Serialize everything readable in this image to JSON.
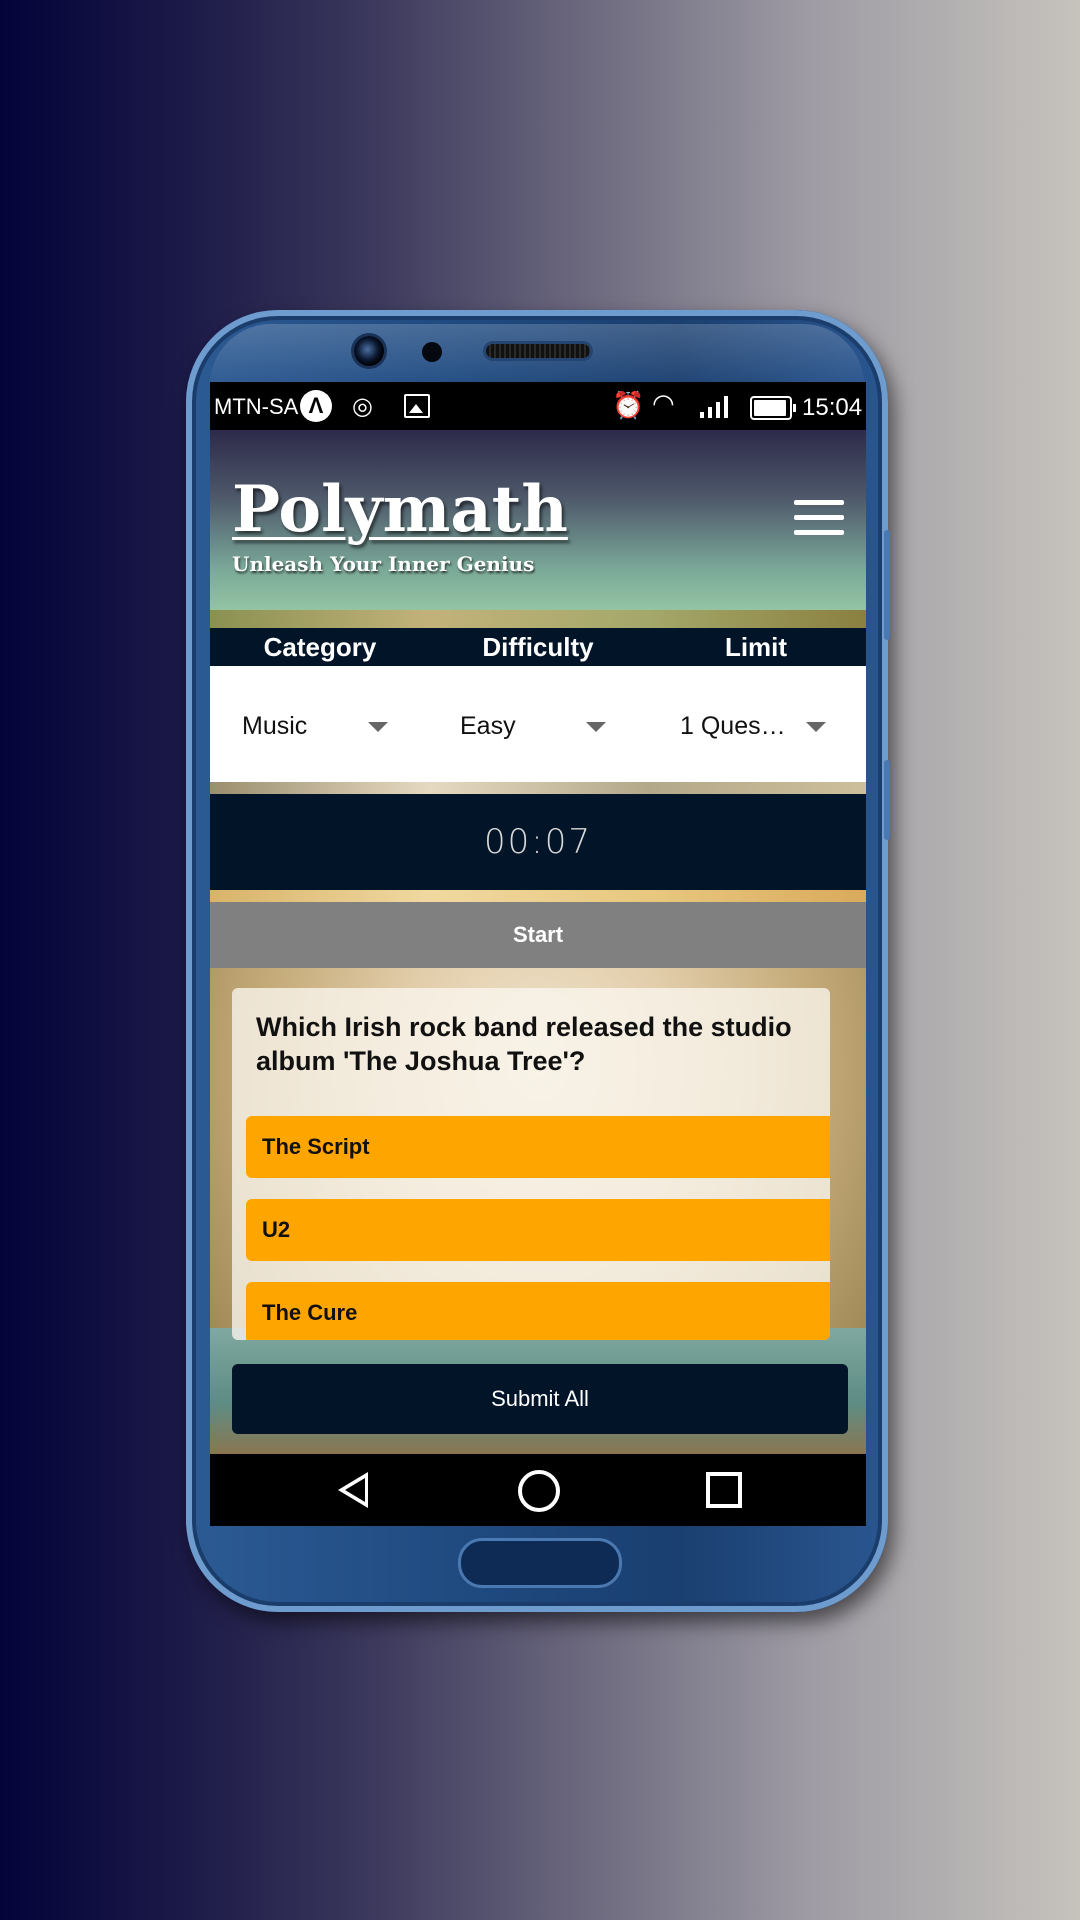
{
  "status_bar": {
    "carrier": "MTN-SA",
    "app_icon_letter": "Λ",
    "time": "15:04",
    "icons": [
      "app-a-icon",
      "location-icon",
      "image-icon",
      "alarm-icon",
      "wifi-icon",
      "signal-icon",
      "battery-icon"
    ]
  },
  "header": {
    "title": "Polymath",
    "tagline": "Unleash Your Inner Genius",
    "menu_icon": "hamburger-menu-icon"
  },
  "filters": {
    "labels": [
      "Category",
      "Difficulty",
      "Limit"
    ],
    "values": [
      "Music",
      "Easy",
      "1 Ques…"
    ]
  },
  "timer": {
    "value": "00:07"
  },
  "start_button": {
    "label": "Start"
  },
  "quiz": {
    "question": "Which Irish rock band released the studio album 'The Joshua Tree'?",
    "answers": [
      "The Script",
      "U2",
      "The Cure"
    ]
  },
  "submit_button": {
    "label": "Submit All"
  },
  "colors": {
    "accent": "#ffa500",
    "dark_navy": "#021428",
    "start_grey": "#808080"
  },
  "navigation": {
    "icons": [
      "back-icon",
      "home-icon",
      "recent-apps-icon"
    ]
  }
}
